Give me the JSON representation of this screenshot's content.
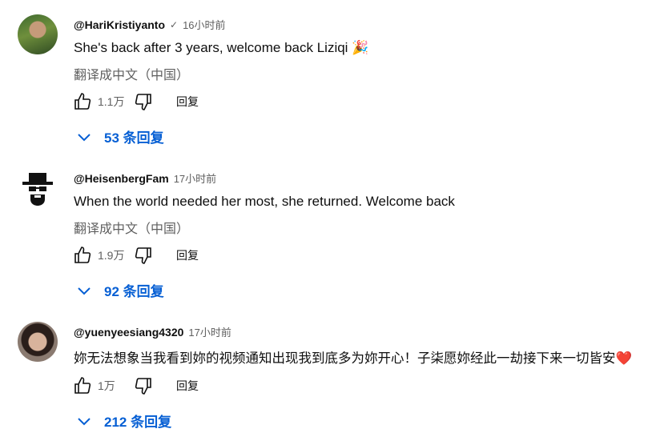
{
  "comments": [
    {
      "author": "@HariKristiyanto",
      "verified": "✓",
      "time": "16小时前",
      "text": "She's back after 3 years, welcome back Liziqi 🎉",
      "translate": "翻译成中文（中国）",
      "likes": "1.1万",
      "reply_label": "回复",
      "replies": "53 条回复"
    },
    {
      "author": "@HeisenbergFam",
      "time": "17小时前",
      "text": "When the world needed her most, she returned. Welcome back",
      "translate": "翻译成中文（中国）",
      "likes": "1.9万",
      "reply_label": "回复",
      "replies": "92 条回复"
    },
    {
      "author": "@yuenyeesiang4320",
      "time": "17小时前",
      "text": "妳无法想象当我看到妳的视频通知出现我到底多为妳开心！子柒愿妳经此一劫接下来一切皆安❤️",
      "likes": "1万",
      "reply_label": "回复",
      "replies": "212 条回复"
    }
  ],
  "colors": {
    "link": "#065fd4",
    "muted": "#606060",
    "text": "#0f0f0f"
  },
  "icons": [
    "thumbs-up-icon",
    "thumbs-down-icon",
    "chevron-down-icon"
  ]
}
